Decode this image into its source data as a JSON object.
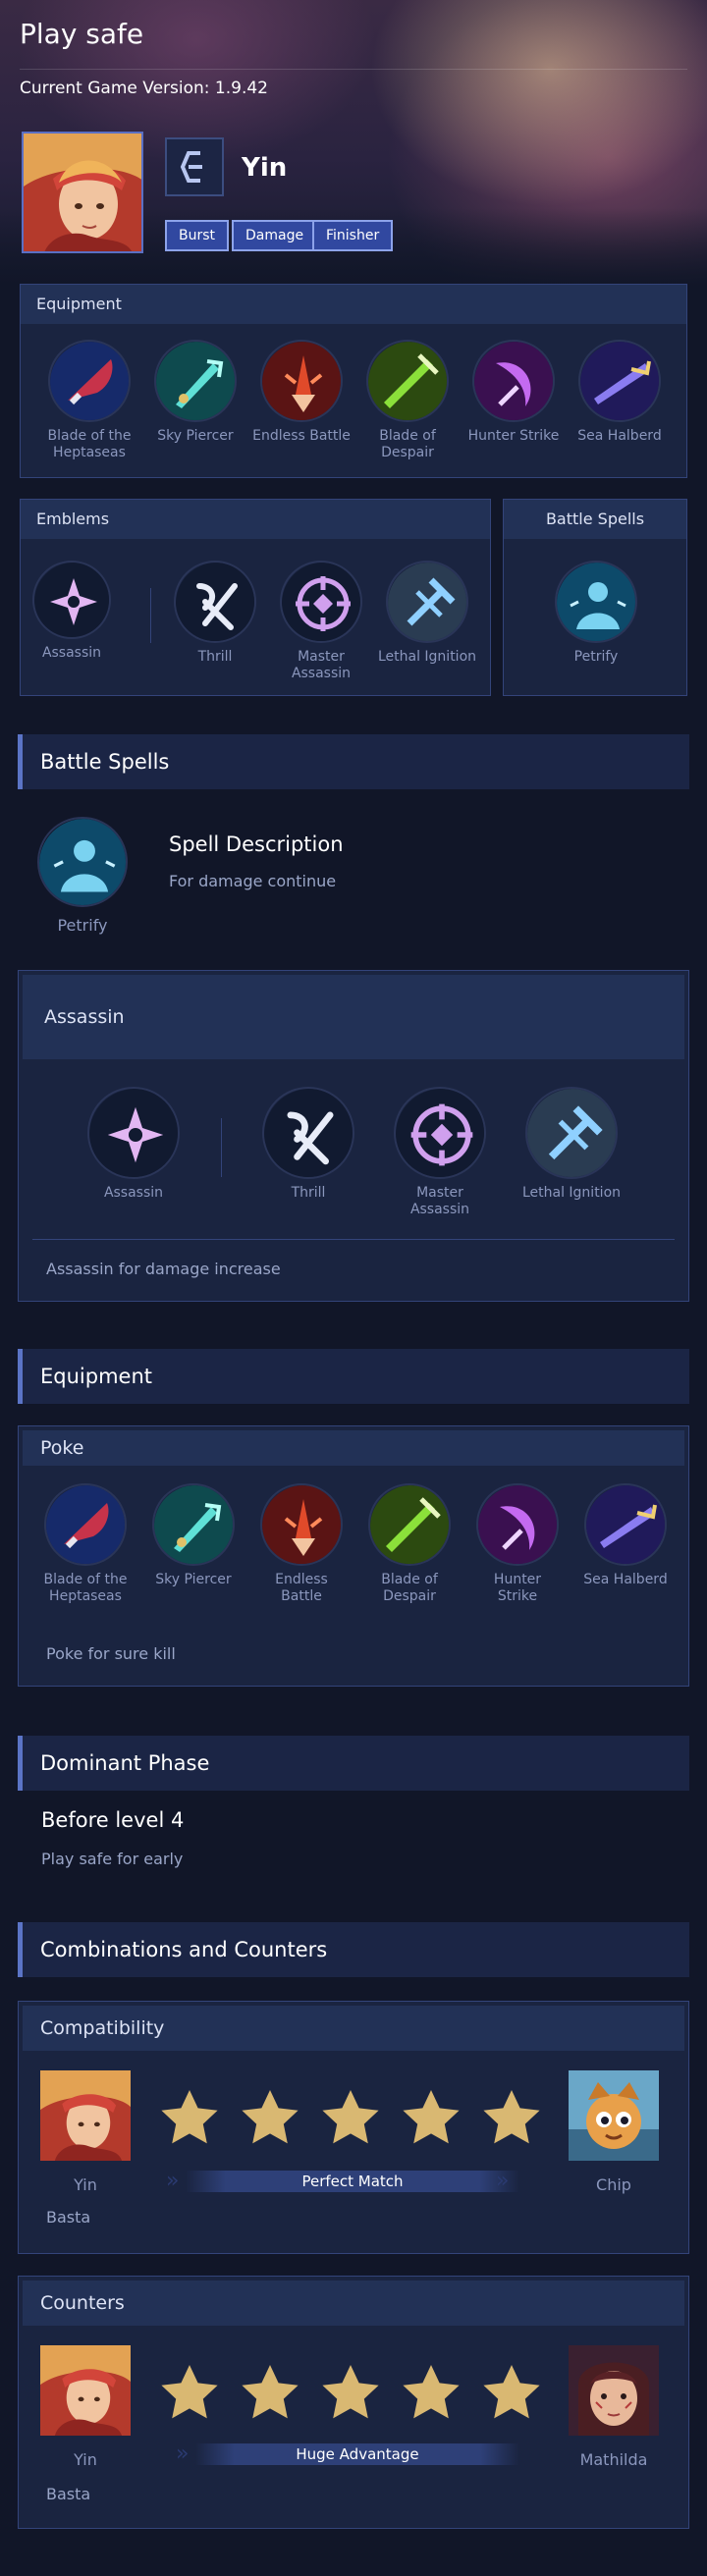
{
  "page_title": "Play safe",
  "version": "Current Game Version: 1.9.42",
  "hero": {
    "name": "Yin",
    "tags": [
      "Burst",
      "Damage",
      "Finisher"
    ]
  },
  "equipment_panel": {
    "title": "Equipment",
    "items": [
      "Blade of the Heptaseas",
      "Sky Piercer",
      "Endless Battle",
      "Blade of Despair",
      "Hunter Strike",
      "Sea Halberd"
    ]
  },
  "emblems_panel": {
    "title": "Emblems",
    "main": "Assassin",
    "talents": [
      "Thrill",
      "Master Assassin",
      "Lethal Ignition"
    ]
  },
  "battle_spell_panel": {
    "title": "Battle Spells",
    "spell": "Petrify"
  },
  "battle_spells_section": {
    "heading": "Battle Spells",
    "spell": "Petrify",
    "desc_title": "Spell Description",
    "desc": "For damage continue"
  },
  "emblem_detail": {
    "title": "Assassin",
    "main": "Assassin",
    "talents": [
      "Thrill",
      "Master Assassin",
      "Lethal Ignition"
    ],
    "note": "Assassin for damage increase"
  },
  "equipment_section": {
    "heading": "Equipment",
    "build_title": "Poke",
    "items": [
      "Blade of the Heptaseas",
      "Sky Piercer",
      "Endless Battle",
      "Blade of Despair",
      "Hunter Strike",
      "Sea Halberd"
    ],
    "note": "Poke for sure kill"
  },
  "dominant_phase": {
    "heading": "Dominant Phase",
    "title": "Before level 4",
    "desc": "Play safe for early"
  },
  "combos": {
    "heading": "Combinations and Counters",
    "compatibility": {
      "title": "Compatibility",
      "left": "Yin",
      "right": "Chip",
      "rating": 5,
      "label": "Perfect Match",
      "note": "Basta"
    },
    "counters": {
      "title": "Counters",
      "left": "Yin",
      "right": "Mathilda",
      "rating": 5,
      "label": "Huge Advantage",
      "note": "Basta"
    }
  },
  "icons": [
    "assassin-emblem-icon",
    "thrill-icon",
    "master-assassin-icon",
    "lethal-ignition-icon",
    "petrify-icon",
    "star-icon",
    "role-icon"
  ],
  "colors": {
    "accent": "#5b74c6",
    "tag": "#3148a0",
    "star": "#d9b872",
    "background": "#111628"
  }
}
